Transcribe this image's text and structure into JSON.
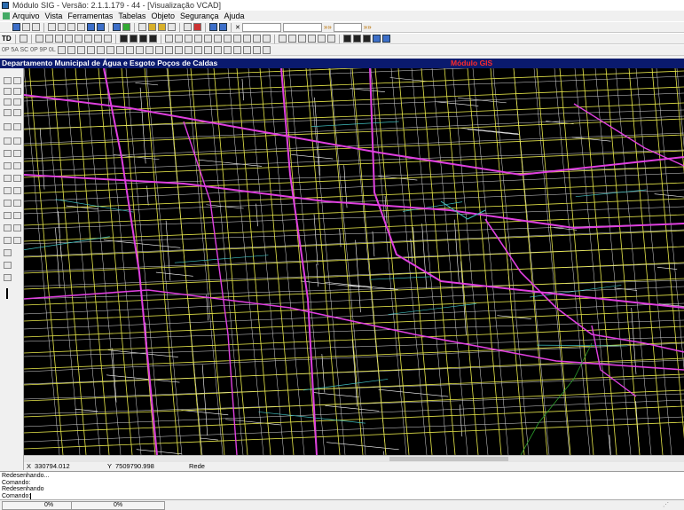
{
  "window": {
    "title": "Módulo SIG - Versão: 2.1.1.179 - 44 - [Visualização VCAD]"
  },
  "menu": {
    "items": [
      "Arquivo",
      "Vista",
      "Ferramentas",
      "Tabelas",
      "Objeto",
      "Segurança",
      "Ajuda"
    ]
  },
  "toolbar2": {
    "label_td": "TD",
    "label_row3": "0P  5A  SC  0P  9P  0L"
  },
  "header": {
    "department": "Departamento Municipal de Água e Esgoto Poços de Caldas",
    "module": "Módulo GIS"
  },
  "map": {
    "background": "#000000",
    "line_colors": {
      "water_mains": "#e040e0",
      "pipes": "#e6e64a",
      "parcels": "#ffffff",
      "network_secondary": "#40c0c0",
      "boundary": "#2ca02c"
    }
  },
  "status": {
    "x_label": "X",
    "x_value": "330794.012",
    "y_label": "Y",
    "y_value": "7509790.998",
    "layer": "Rede"
  },
  "command": {
    "lines": [
      "Redesenhando...",
      "Comando:",
      "Redesenhando",
      "Comando: "
    ]
  },
  "bottom": {
    "cell1": "0%",
    "cell2": "0%"
  }
}
